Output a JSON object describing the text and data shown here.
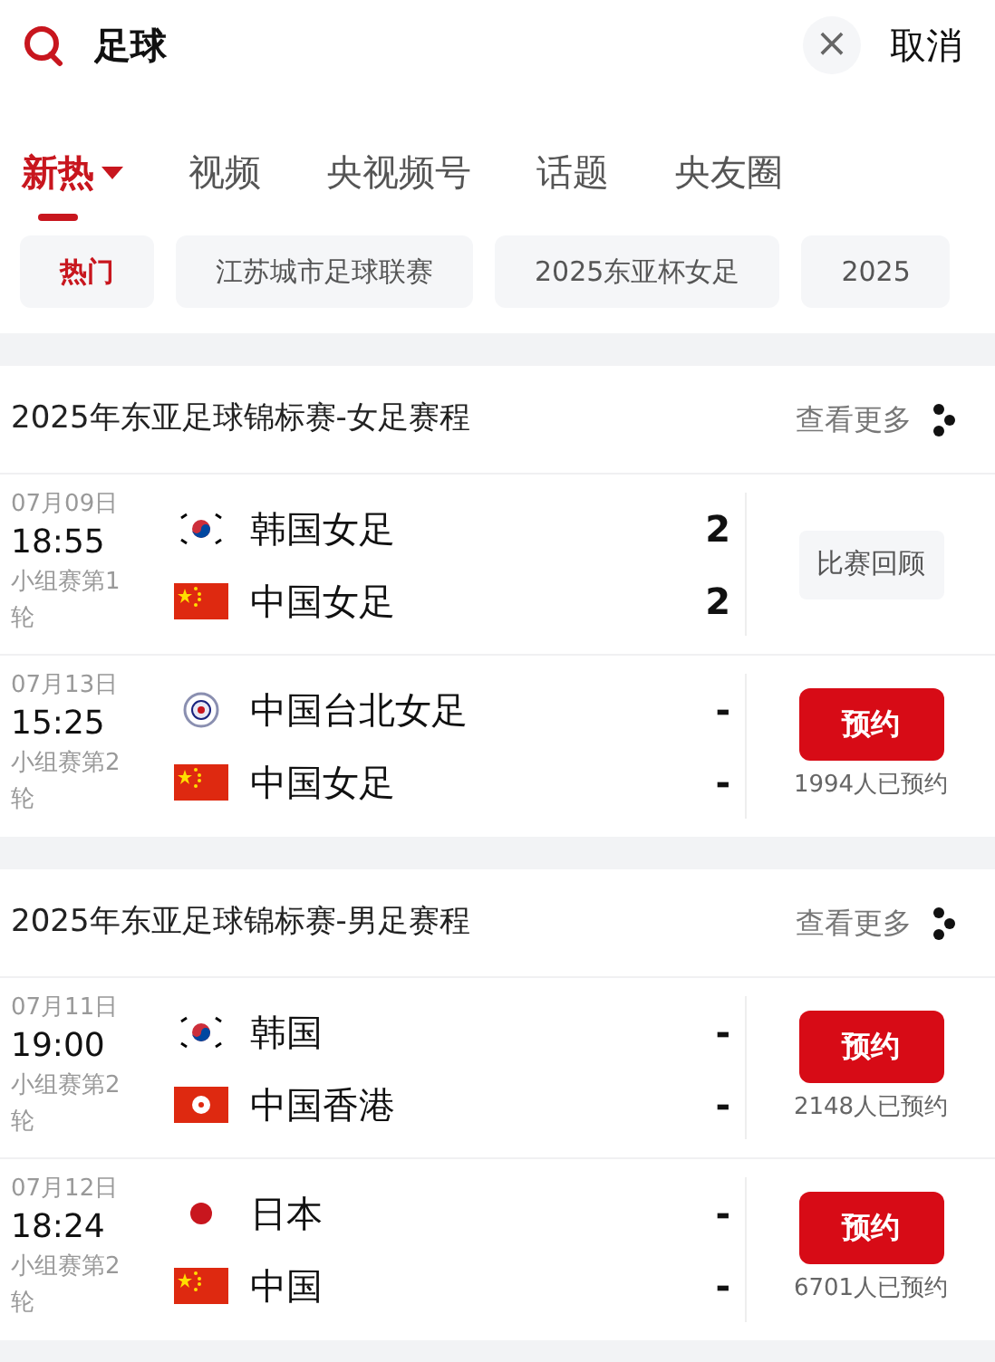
{
  "search": {
    "value": "足球",
    "clear": "×",
    "cancel": "取消"
  },
  "tabs": [
    {
      "label": "新热",
      "selected": true,
      "dropdown": true
    },
    {
      "label": "视频",
      "selected": false,
      "dropdown": false
    },
    {
      "label": "央视频号",
      "selected": false,
      "dropdown": false
    },
    {
      "label": "话题",
      "selected": false,
      "dropdown": false
    },
    {
      "label": "央友圈",
      "selected": false,
      "dropdown": false
    }
  ],
  "chips": [
    {
      "label": "热门",
      "selected": true
    },
    {
      "label": "江苏城市足球联赛",
      "selected": false
    },
    {
      "label": "2025东亚杯女足",
      "selected": false
    },
    {
      "label": "2025",
      "selected": false
    }
  ],
  "sections": [
    {
      "title": "2025年东亚足球锦标赛-女足赛程",
      "more": "查看更多",
      "matches": [
        {
          "date": "07月09日",
          "time": "18:55",
          "round": "小组赛第1轮",
          "teams": [
            {
              "name": "韩国女足",
              "kind": "kr",
              "score": "2"
            },
            {
              "name": "中国女足",
              "kind": "cn",
              "score": "2"
            }
          ],
          "action": {
            "kind": "replay",
            "label": "比赛回顾"
          }
        },
        {
          "date": "07月13日",
          "time": "15:25",
          "round": "小组赛第2轮",
          "teams": [
            {
              "name": "中国台北女足",
              "kind": "tpe",
              "score": "-"
            },
            {
              "name": "中国女足",
              "kind": "cn",
              "score": "-"
            }
          ],
          "action": {
            "kind": "reserve",
            "label": "预约",
            "count": "1994人已预约"
          }
        }
      ]
    },
    {
      "title": "2025年东亚足球锦标赛-男足赛程",
      "more": "查看更多",
      "matches": [
        {
          "date": "07月11日",
          "time": "19:00",
          "round": "小组赛第2轮",
          "teams": [
            {
              "name": "韩国",
              "kind": "kr",
              "score": "-"
            },
            {
              "name": "中国香港",
              "kind": "hk",
              "score": "-"
            }
          ],
          "action": {
            "kind": "reserve",
            "label": "预约",
            "count": "2148人已预约"
          }
        },
        {
          "date": "07月12日",
          "time": "18:24",
          "round": "小组赛第2轮",
          "teams": [
            {
              "name": "日本",
              "kind": "jp",
              "score": "-"
            },
            {
              "name": "中国",
              "kind": "cn",
              "score": "-"
            }
          ],
          "action": {
            "kind": "reserve",
            "label": "预约",
            "count": "6701人已预约"
          }
        }
      ]
    }
  ]
}
